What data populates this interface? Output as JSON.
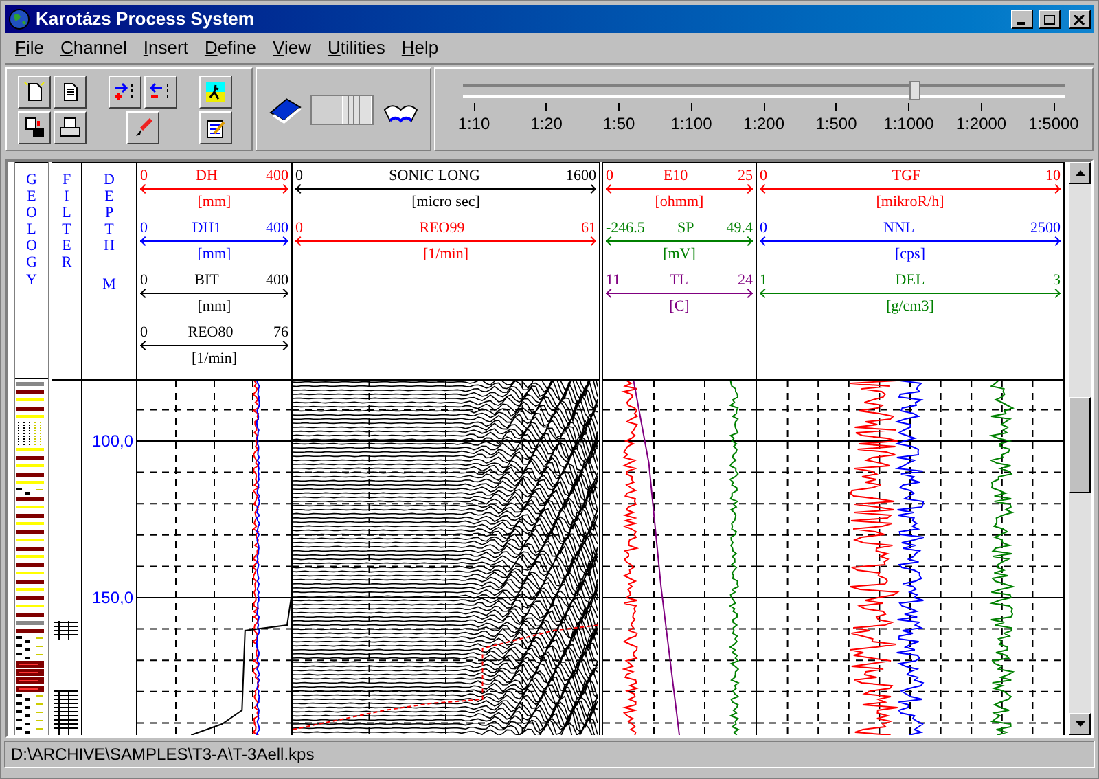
{
  "window": {
    "title": "Karotázs Process System"
  },
  "menu": [
    "File",
    "Channel",
    "Insert",
    "Define",
    "View",
    "Utilities",
    "Help"
  ],
  "page_toggle": {
    "on": true
  },
  "scale_slider": {
    "ticks": [
      "1:10",
      "1:20",
      "1:50",
      "1:100",
      "1:200",
      "1:500",
      "1:1000",
      "1:2000",
      "1:5000"
    ],
    "level": 0.75
  },
  "side_headers": {
    "geology": "GEOLOGY",
    "filter": "FILTER",
    "depth": "DEPTH",
    "depth_unit": "M"
  },
  "tracks": [
    {
      "curves": [
        {
          "min": "0",
          "name": "DH",
          "max": "400",
          "unit": "[mm]",
          "color": "#ff0000"
        },
        {
          "min": "0",
          "name": "DH1",
          "max": "400",
          "unit": "[mm]",
          "color": "#0000ff"
        },
        {
          "min": "0",
          "name": "BIT",
          "max": "400",
          "unit": "[mm]",
          "color": "#000000"
        },
        {
          "min": "0",
          "name": "REO80",
          "max": "76",
          "unit": "[1/min]",
          "color": "#000000"
        }
      ]
    },
    {
      "curves": [
        {
          "min": "0",
          "name": "SONIC LONG",
          "max": "1600",
          "unit": "[micro sec]",
          "color": "#000000"
        },
        {
          "min": "0",
          "name": "REO99",
          "max": "61",
          "unit": "[1/min]",
          "color": "#ff0000"
        }
      ]
    },
    {
      "curves": [
        {
          "min": "0",
          "name": "E10",
          "max": "25",
          "unit": "[ohmm]",
          "color": "#ff0000"
        },
        {
          "min": "-246.5",
          "name": "SP",
          "max": "49.4",
          "unit": "[mV]",
          "color": "#008000"
        },
        {
          "min": "11",
          "name": "TL",
          "max": "24",
          "unit": "[C]",
          "color": "#800080"
        }
      ]
    },
    {
      "curves": [
        {
          "min": "0",
          "name": "TGF",
          "max": "10",
          "unit": "[mikroR/h]",
          "color": "#ff0000"
        },
        {
          "min": "0",
          "name": "NNL",
          "max": "2500",
          "unit": "[cps]",
          "color": "#0000ff"
        },
        {
          "min": "1",
          "name": "DEL",
          "max": "3",
          "unit": "[g/cm3]",
          "color": "#008000"
        }
      ]
    }
  ],
  "depth_labels": [
    "100,0",
    "150,0"
  ],
  "status_bar": {
    "path": "D:\\ARCHIVE\\SAMPLES\\T3-A\\T-3Aell.kps"
  }
}
